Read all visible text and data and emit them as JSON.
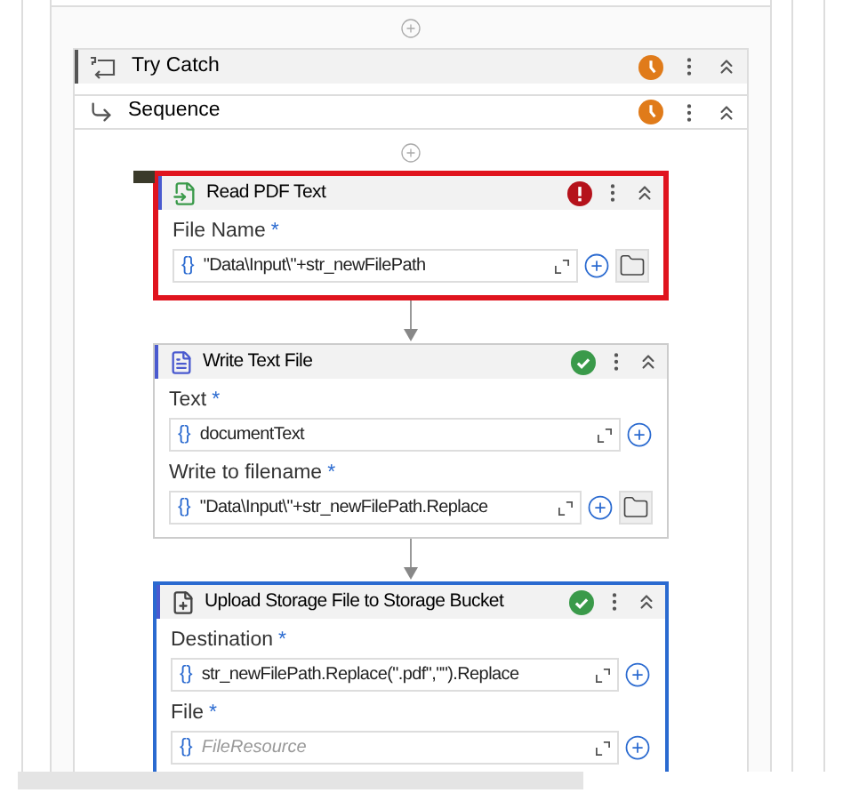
{
  "containers": [
    {
      "kind": "try_catch",
      "title": "Try Catch",
      "warning": true,
      "active": true
    },
    {
      "kind": "sequence",
      "title": "Sequence",
      "warning": true,
      "active": false
    }
  ],
  "activities": [
    {
      "kind": "read_pdf",
      "title": "Read PDF Text",
      "error": true,
      "selected": false,
      "fields": [
        {
          "label": "File Name",
          "required_mark": "*",
          "prefix": "{}",
          "value": "\"Data\\Input\\\"+str_newFilePath",
          "browse": true
        }
      ]
    },
    {
      "kind": "write_text",
      "title": "Write Text File",
      "error": false,
      "selected": false,
      "fields": [
        {
          "label": "Text",
          "required_mark": "*",
          "prefix": "{}",
          "value": "documentText",
          "browse": false
        },
        {
          "label": "Write to filename",
          "required_mark": "*",
          "prefix": "{}",
          "value": "\"Data\\Input\\\"+str_newFilePath.Replace",
          "browse": true
        }
      ]
    },
    {
      "kind": "upload",
      "title": "Upload Storage File to Storage Bucket",
      "error": false,
      "selected": true,
      "fields": [
        {
          "label": "Destination",
          "required_mark": "*",
          "prefix": "{}",
          "value": "str_newFilePath.Replace(\".pdf\",\"\").Replace",
          "browse": false
        },
        {
          "label": "File",
          "required_mark": "*",
          "prefix": "{}",
          "placeholder": "FileResource",
          "browse": false
        }
      ]
    }
  ]
}
